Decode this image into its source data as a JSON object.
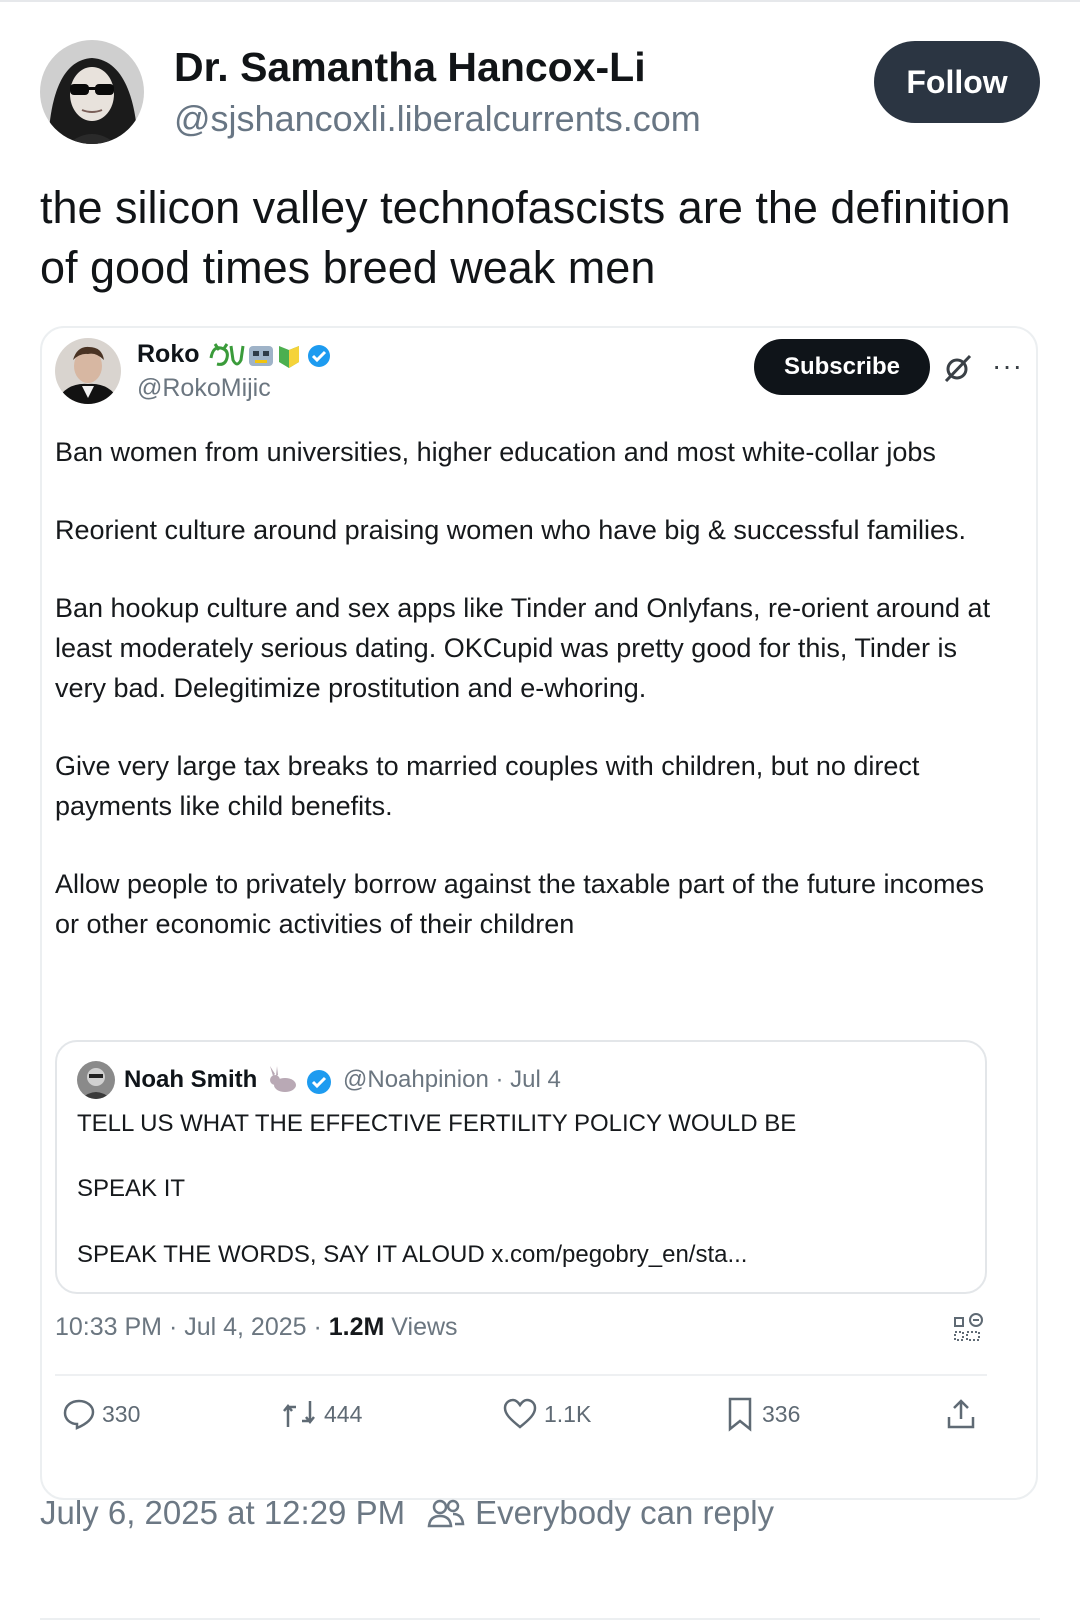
{
  "post": {
    "author_name": "Dr. Samantha Hancox-Li",
    "author_handle": "@sjshancoxli.liberalcurrents.com",
    "follow_label": "Follow",
    "text": "the silicon valley technofascists are the definition of good times breed weak men",
    "timestamp": "July 6, 2025 at 12:29 PM",
    "reply_setting": "Everybody can reply"
  },
  "embedded": {
    "author_name": "Roko",
    "author_handle": "@RokoMijic",
    "subscribe_label": "Subscribe",
    "paragraphs": [
      "Ban women from universities, higher education and most white-collar jobs",
      "Reorient culture around praising women who have big & successful families.",
      "Ban hookup culture and sex apps like Tinder and Onlyfans, re-orient around at least moderately serious dating. OKCupid was pretty good for this, Tinder is very bad. Delegitimize prostitution and e-whoring.",
      "Give very large tax breaks to married couples with children, but no direct payments like child benefits.",
      "Allow people to privately borrow against the taxable part of the future incomes or other economic activities of their children"
    ],
    "quote": {
      "author_name": "Noah Smith",
      "author_handle": "@Noahpinion · Jul 4",
      "lines": [
        "TELL US WHAT THE EFFECTIVE FERTILITY POLICY WOULD BE",
        "SPEAK IT",
        "SPEAK THE WORDS, SAY IT ALOUD x.com/pegobry_en/sta..."
      ]
    },
    "meta": {
      "time": "10:33 PM · Jul 4, 2025 · ",
      "views_count": "1.2M",
      "views_label": " Views"
    },
    "actions": {
      "replies": "330",
      "reposts": "444",
      "likes": "1.1K",
      "bookmarks": "336"
    }
  },
  "colors": {
    "follow_bg": "#2b3542",
    "verified": "#1d9bf0",
    "muted_text": "#687684"
  }
}
